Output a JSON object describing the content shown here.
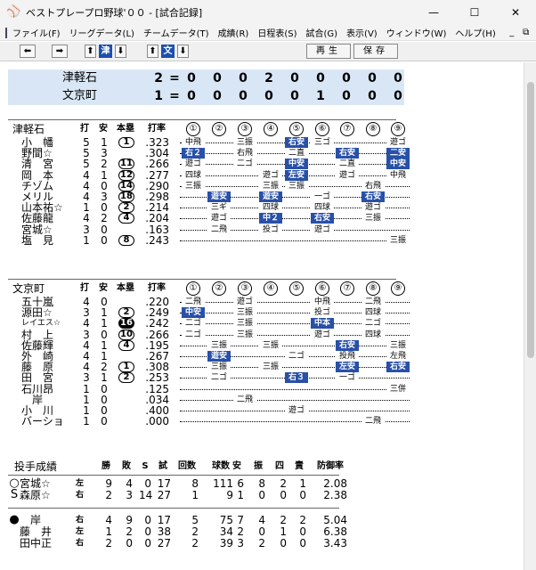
{
  "window": {
    "title": "ベストプレープロ野球'００ - [試合記録]",
    "controls": {
      "minimize": "—",
      "maximize": "☐",
      "close": "✕"
    }
  },
  "menu": [
    "ファイル(F)",
    "リーグデータ(L)",
    "チームデータ(T)",
    "成績(R)",
    "日程表(S)",
    "試合(G)",
    "表示(V)",
    "ウィンドウ(W)",
    "ヘルプ(H)"
  ],
  "menu_right": [
    "_",
    "⧉",
    "×"
  ],
  "toolbar": {
    "prev": "⬅",
    "next": "➡",
    "team1_up": "⬆",
    "team1": "津",
    "team1_down": "⬇",
    "team2_up": "⬆",
    "team2": "文",
    "team2_down": "⬇",
    "replay": "再生",
    "save": "保存"
  },
  "colors": {
    "accent": "#2850a8",
    "linescore_bg": "#d9e6f5"
  },
  "linescore": [
    {
      "team": "津軽石",
      "runs": "2",
      "cmp": "=",
      "innings": [
        "0",
        "0",
        "0",
        "2",
        "0",
        "0",
        "0",
        "0",
        "0"
      ]
    },
    {
      "team": "文京町",
      "runs": "1",
      "cmp": "=",
      "innings": [
        "0",
        "0",
        "0",
        "0",
        "0",
        "1",
        "0",
        "0",
        "0"
      ]
    }
  ],
  "batting_headers": {
    "ab": "打",
    "h": "安",
    "hr": "本塁",
    "avg": "打率",
    "innings": [
      "①",
      "②",
      "③",
      "④",
      "⑤",
      "⑥",
      "⑦",
      "⑧",
      "⑨"
    ]
  },
  "batting": [
    {
      "team": "津軽石",
      "players": [
        {
          "name": "小　幡",
          "ab": "5",
          "h": "1",
          "hr": "1",
          "avg": ".323",
          "res": [
            [
              "中飛",
              0
            ],
            [
              "",
              0
            ],
            [
              "三振",
              0
            ],
            [
              "",
              0
            ],
            [
              "右安",
              1
            ],
            [
              "三ゴ",
              0
            ],
            [
              "",
              0
            ],
            [
              "",
              0
            ],
            [
              "遊ゴ",
              0
            ]
          ]
        },
        {
          "name": "野間☆",
          "ab": "5",
          "h": "3",
          "hr": "",
          "avg": ".304",
          "res": [
            [
              "右２",
              1
            ],
            [
              "",
              0
            ],
            [
              "右飛",
              0
            ],
            [
              "",
              0
            ],
            [
              "二直",
              0
            ],
            [
              "",
              0
            ],
            [
              "右安",
              1
            ],
            [
              "",
              0
            ],
            [
              "二安",
              1
            ]
          ]
        },
        {
          "name": "清　宮",
          "ab": "5",
          "h": "2",
          "hr": "11",
          "avg": ".266",
          "res": [
            [
              "遊ゴ",
              0
            ],
            [
              "",
              0
            ],
            [
              "二ゴ",
              0
            ],
            [
              "",
              0
            ],
            [
              "中安",
              1
            ],
            [
              "",
              0
            ],
            [
              "二直",
              0
            ],
            [
              "",
              0
            ],
            [
              "中安",
              1
            ]
          ]
        },
        {
          "name": "岡　本",
          "ab": "4",
          "h": "1",
          "hr": "12",
          "avg": ".277",
          "res": [
            [
              "四球",
              0
            ],
            [
              "",
              0
            ],
            [
              "",
              0
            ],
            [
              "遊ゴ",
              0
            ],
            [
              "左安",
              1
            ],
            [
              "",
              0
            ],
            [
              "遊ゴ",
              0
            ],
            [
              "",
              0
            ],
            [
              "中飛",
              0
            ]
          ]
        },
        {
          "name": "チゾム",
          "ab": "4",
          "h": "0",
          "hr": "14",
          "avg": ".290",
          "res": [
            [
              "三振",
              0
            ],
            [
              "",
              0
            ],
            [
              "",
              0
            ],
            [
              "三振",
              0
            ],
            [
              "三振",
              0
            ],
            [
              "",
              0
            ],
            [
              "",
              0
            ],
            [
              "右飛",
              0
            ],
            [
              "",
              0
            ]
          ]
        },
        {
          "name": "メリル",
          "ab": "4",
          "h": "3",
          "hr": "18",
          "avg": ".298",
          "res": [
            [
              "",
              0
            ],
            [
              "遊安",
              1
            ],
            [
              "",
              0
            ],
            [
              "遊安",
              1
            ],
            [
              "",
              0
            ],
            [
              "一ゴ",
              0
            ],
            [
              "",
              0
            ],
            [
              "右安",
              1
            ],
            [
              "",
              0
            ]
          ]
        },
        {
          "name": "山本祐☆",
          "ab": "1",
          "h": "0",
          "hr": "2",
          "avg": ".214",
          "res": [
            [
              "",
              0
            ],
            [
              "三ギ",
              0
            ],
            [
              "",
              0
            ],
            [
              "四球",
              0
            ],
            [
              "",
              0
            ],
            [
              "四球",
              0
            ],
            [
              "",
              0
            ],
            [
              "遊ゴ",
              0
            ],
            [
              "",
              0
            ]
          ]
        },
        {
          "name": "佐藤龍",
          "ab": "4",
          "h": "2",
          "hr": "4",
          "avg": ".204",
          "res": [
            [
              "",
              0
            ],
            [
              "遊ゴ",
              0
            ],
            [
              "",
              0
            ],
            [
              "中２",
              1
            ],
            [
              "",
              0
            ],
            [
              "右安",
              1
            ],
            [
              "",
              0
            ],
            [
              "三振",
              0
            ],
            [
              "",
              0
            ]
          ]
        },
        {
          "name": "宮城☆",
          "ab": "3",
          "h": "0",
          "hr": "",
          "avg": ".163",
          "res": [
            [
              "",
              0
            ],
            [
              "二飛",
              0
            ],
            [
              "",
              0
            ],
            [
              "投ゴ",
              0
            ],
            [
              "",
              0
            ],
            [
              "遊ゴ",
              0
            ],
            [
              "",
              0
            ],
            [
              "",
              0
            ],
            [
              "",
              0
            ]
          ]
        },
        {
          "name": "塩　見",
          "ab": "1",
          "h": "0",
          "hr": "8",
          "avg": ".243",
          "res": [
            [
              "",
              0
            ],
            [
              "",
              0
            ],
            [
              "",
              0
            ],
            [
              "",
              0
            ],
            [
              "",
              0
            ],
            [
              "",
              0
            ],
            [
              "",
              0
            ],
            [
              "",
              0
            ],
            [
              "三振",
              0
            ]
          ]
        }
      ]
    },
    {
      "team": "文京町",
      "players": [
        {
          "name": "五十嵐",
          "ab": "4",
          "h": "0",
          "hr": "",
          "avg": ".220",
          "res": [
            [
              "二飛",
              0
            ],
            [
              "",
              0
            ],
            [
              "遊ゴ",
              0
            ],
            [
              "",
              0
            ],
            [
              "",
              0
            ],
            [
              "中飛",
              0
            ],
            [
              "",
              0
            ],
            [
              "二飛",
              0
            ],
            [
              "",
              0
            ]
          ]
        },
        {
          "name": "源田☆",
          "ab": "3",
          "h": "1",
          "hr": "2",
          "avg": ".249",
          "res": [
            [
              "中安",
              1
            ],
            [
              "",
              0
            ],
            [
              "三振",
              0
            ],
            [
              "",
              0
            ],
            [
              "",
              0
            ],
            [
              "投ゴ",
              0
            ],
            [
              "",
              0
            ],
            [
              "四球",
              0
            ],
            [
              "",
              0
            ]
          ]
        },
        {
          "name": "レイエス☆",
          "ab": "4",
          "h": "1",
          "hr": "16",
          "hrfilled": true,
          "avg": ".242",
          "res": [
            [
              "二ゴ",
              0
            ],
            [
              "",
              0
            ],
            [
              "三振",
              0
            ],
            [
              "",
              0
            ],
            [
              "",
              0
            ],
            [
              "中本",
              1
            ],
            [
              "",
              0
            ],
            [
              "二ゴ",
              0
            ],
            [
              "",
              0
            ]
          ]
        },
        {
          "name": "村　上",
          "ab": "3",
          "h": "0",
          "hr": "10",
          "avg": ".266",
          "res": [
            [
              "二ゴ",
              0
            ],
            [
              "",
              0
            ],
            [
              "三振",
              0
            ],
            [
              "",
              0
            ],
            [
              "",
              0
            ],
            [
              "遊ゴ",
              0
            ],
            [
              "",
              0
            ],
            [
              "四球",
              0
            ],
            [
              "",
              0
            ]
          ]
        },
        {
          "name": "佐藤輝",
          "ab": "4",
          "h": "1",
          "hr": "4",
          "avg": ".195",
          "res": [
            [
              "",
              0
            ],
            [
              "三振",
              0
            ],
            [
              "",
              0
            ],
            [
              "三振",
              0
            ],
            [
              "",
              0
            ],
            [
              "",
              0
            ],
            [
              "右安",
              1
            ],
            [
              "",
              0
            ],
            [
              "三振",
              0
            ]
          ]
        },
        {
          "name": "外　崎",
          "ab": "4",
          "h": "1",
          "hr": "",
          "avg": ".267",
          "res": [
            [
              "",
              0
            ],
            [
              "遊安",
              1
            ],
            [
              "",
              0
            ],
            [
              "",
              0
            ],
            [
              "二ゴ",
              0
            ],
            [
              "",
              0
            ],
            [
              "投飛",
              0
            ],
            [
              "",
              0
            ],
            [
              "左飛",
              0
            ]
          ]
        },
        {
          "name": "藤　原",
          "ab": "4",
          "h": "2",
          "hr": "1",
          "avg": ".308",
          "res": [
            [
              "",
              0
            ],
            [
              "三振",
              0
            ],
            [
              "",
              0
            ],
            [
              "三振",
              0
            ],
            [
              "",
              0
            ],
            [
              "",
              0
            ],
            [
              "左安",
              1
            ],
            [
              "",
              0
            ],
            [
              "右安",
              1
            ]
          ]
        },
        {
          "name": "田　宮",
          "ab": "3",
          "h": "1",
          "hr": "2",
          "avg": ".253",
          "res": [
            [
              "",
              0
            ],
            [
              "二ゴ",
              0
            ],
            [
              "",
              0
            ],
            [
              "",
              0
            ],
            [
              "右３",
              1
            ],
            [
              "",
              0
            ],
            [
              "一ゴ",
              0
            ],
            [
              "",
              0
            ],
            [
              "",
              0
            ]
          ]
        },
        {
          "name": "石川昂",
          "ab": "1",
          "h": "0",
          "hr": "",
          "avg": ".125",
          "res": [
            [
              "",
              0
            ],
            [
              "",
              0
            ],
            [
              "",
              0
            ],
            [
              "",
              0
            ],
            [
              "",
              0
            ],
            [
              "",
              0
            ],
            [
              "",
              0
            ],
            [
              "",
              0
            ],
            [
              "三併",
              0
            ]
          ]
        },
        {
          "name": "　岸",
          "ab": "1",
          "h": "0",
          "hr": "",
          "avg": ".034",
          "res": [
            [
              "",
              0
            ],
            [
              "",
              0
            ],
            [
              "二飛",
              0
            ],
            [
              "",
              0
            ],
            [
              "",
              0
            ],
            [
              "",
              0
            ],
            [
              "",
              0
            ],
            [
              "",
              0
            ],
            [
              "",
              0
            ]
          ]
        },
        {
          "name": "小　川",
          "ab": "1",
          "h": "0",
          "hr": "",
          "avg": ".400",
          "res": [
            [
              "",
              0
            ],
            [
              "",
              0
            ],
            [
              "",
              0
            ],
            [
              "",
              0
            ],
            [
              "遊ゴ",
              0
            ],
            [
              "",
              0
            ],
            [
              "",
              0
            ],
            [
              "",
              0
            ],
            [
              "",
              0
            ]
          ]
        },
        {
          "name": "バーショ",
          "ab": "1",
          "h": "0",
          "hr": "",
          "avg": ".000",
          "res": [
            [
              "",
              0
            ],
            [
              "",
              0
            ],
            [
              "",
              0
            ],
            [
              "",
              0
            ],
            [
              "",
              0
            ],
            [
              "",
              0
            ],
            [
              "",
              0
            ],
            [
              "二飛",
              0
            ],
            [
              "",
              0
            ]
          ]
        }
      ]
    }
  ],
  "pitching": {
    "title": "投手成績",
    "headers": [
      "勝",
      "敗",
      "S",
      "試",
      "回数",
      "球数",
      "安",
      "振",
      "四",
      "責",
      "防御率"
    ],
    "groups": [
      [
        {
          "mark": "○",
          "name": "宮城☆",
          "hand": "左",
          "vals": [
            "9",
            "4",
            "0",
            "17",
            "8",
            "111",
            "6",
            "8",
            "2",
            "1",
            "2.08"
          ]
        },
        {
          "mark": "S",
          "name": "森原☆",
          "hand": "右",
          "vals": [
            "2",
            "3",
            "14",
            "27",
            "1",
            "9",
            "1",
            "0",
            "0",
            "0",
            "2.38"
          ]
        }
      ],
      [
        {
          "mark": "●",
          "name": "　岸",
          "hand": "右",
          "vals": [
            "4",
            "9",
            "0",
            "17",
            "5",
            "75",
            "7",
            "4",
            "2",
            "2",
            "5.04"
          ]
        },
        {
          "mark": "",
          "name": "藤　井",
          "hand": "左",
          "vals": [
            "1",
            "2",
            "0",
            "38",
            "2",
            "34",
            "2",
            "0",
            "1",
            "0",
            "6.38"
          ]
        },
        {
          "mark": "",
          "name": "田中正",
          "hand": "右",
          "vals": [
            "2",
            "0",
            "0",
            "27",
            "2",
            "39",
            "3",
            "2",
            "0",
            "0",
            "3.43"
          ]
        }
      ]
    ]
  }
}
